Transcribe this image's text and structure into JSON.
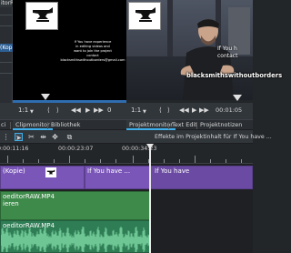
{
  "window_title_fragment": "itorRAW",
  "left_panel": {
    "selected_item": "(Kopie)"
  },
  "clip_monitor": {
    "overlay_lines": [
      "If You have experience",
      "in editing videos and",
      "want to join the project",
      "contact",
      "blacksmithswithoutborders@gmail.com"
    ],
    "zoom": "1:1",
    "timecode": "0"
  },
  "project_monitor": {
    "overlay_line_1": "If You h",
    "overlay_line_2": "contact",
    "channel_text": "blacksmithswithoutborders",
    "zoom": "1:1",
    "timecode": "00:01:05"
  },
  "tabs": {
    "left_fragment": "ci",
    "clip_monitor": "Clipmonitor",
    "library": "Bibliothek",
    "project_monitor": "Projektmonitor",
    "text_edit": "Text Edit",
    "project_notes": "Projektnotizen"
  },
  "timeline_toolbar": {
    "effects_text": "Effekte im Projektinhalt für If You have ..."
  },
  "ruler": {
    "times": [
      "0:00:11:16",
      "00:00:23:07",
      "00:00:34:23"
    ]
  },
  "tracks": {
    "video_clip_1_name": "(Kopie)",
    "video_clip_2_name": "If You have ...",
    "video_clip_3_name": "If You have",
    "linked_clip_name": "oeditorRAW.MP4",
    "linked_clip_subtitle": "ieren",
    "audio_clip_name": "oeditorRAW.MP4"
  },
  "colors": {
    "accent": "#3daee9",
    "video_clip": "#7a56b8",
    "linked_clip": "#3e8a4a",
    "audio_clip": "#2f7d55",
    "progress": "#2f6db0"
  }
}
